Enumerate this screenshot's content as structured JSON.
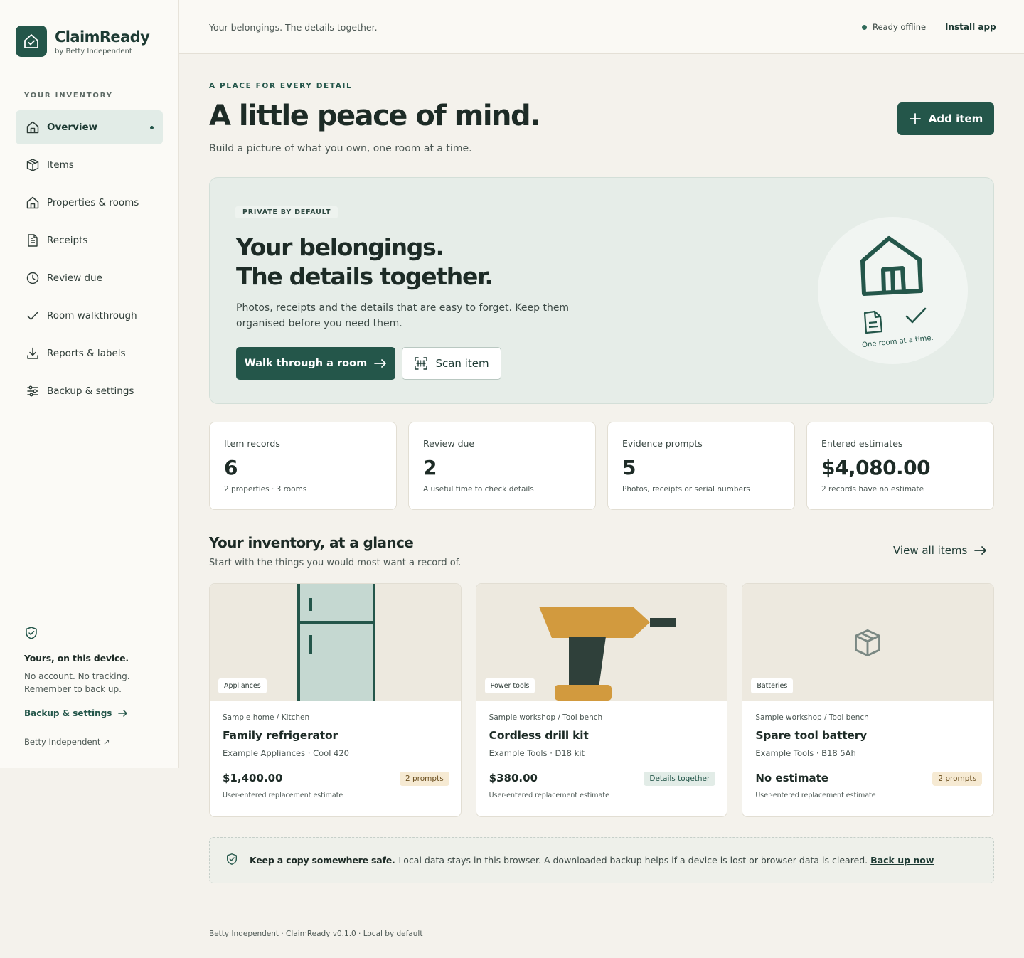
{
  "brand": {
    "name": "ClaimReady",
    "sub": "by Betty Independent"
  },
  "sidebar": {
    "heading": "YOUR INVENTORY",
    "items": [
      {
        "label": "Overview",
        "icon": "home-icon",
        "active": true
      },
      {
        "label": "Items",
        "icon": "box-icon"
      },
      {
        "label": "Properties & rooms",
        "icon": "home-icon"
      },
      {
        "label": "Receipts",
        "icon": "document-icon"
      },
      {
        "label": "Review due",
        "icon": "clock-icon"
      },
      {
        "label": "Room walkthrough",
        "icon": "check-icon"
      },
      {
        "label": "Reports & labels",
        "icon": "download-icon"
      },
      {
        "label": "Backup & settings",
        "icon": "sliders-icon"
      }
    ],
    "footer": {
      "title": "Yours, on this device.",
      "text1": "No account. No tracking.",
      "text2": "Remember to back up.",
      "link": "Backup & settings",
      "credit": "Betty Independent ↗"
    }
  },
  "topbar": {
    "tagline": "Your belongings. The details together.",
    "status": "Ready offline",
    "install": "Install app"
  },
  "page": {
    "eyebrow": "A PLACE FOR EVERY DETAIL",
    "title": "A little peace of mind.",
    "subtitle": "Build a picture of what you own, one room at a time.",
    "add_button": "Add item"
  },
  "hero": {
    "tag": "PRIVATE BY DEFAULT",
    "title_line1": "Your belongings.",
    "title_line2": "The details together.",
    "text": "Photos, receipts and the details that are easy to forget. Keep them organised before you need them.",
    "walk_button": "Walk through a room",
    "scan_button": "Scan item",
    "art_caption": "One room at a time."
  },
  "stats": [
    {
      "label": "Item records",
      "value": "6",
      "sub": "2 properties · 3 rooms"
    },
    {
      "label": "Review due",
      "value": "2",
      "sub": "A useful time to check details"
    },
    {
      "label": "Evidence prompts",
      "value": "5",
      "sub": "Photos, receipts or serial numbers"
    },
    {
      "label": "Entered estimates",
      "value": "$4,080.00",
      "sub": "2 records have no estimate"
    }
  ],
  "glance": {
    "title": "Your inventory, at a glance",
    "subtitle": "Start with the things you would most want a record of.",
    "view_all": "View all items"
  },
  "cards": [
    {
      "category": "Appliances",
      "location": "Sample home / Kitchen",
      "name": "Family refrigerator",
      "model": "Example Appliances · Cool 420",
      "price": "$1,400.00",
      "note": "User-entered replacement estimate",
      "badge": "2 prompts",
      "badge_type": "warn"
    },
    {
      "category": "Power tools",
      "location": "Sample workshop / Tool bench",
      "name": "Cordless drill kit",
      "model": "Example Tools · D18 kit",
      "price": "$380.00",
      "note": "User-entered replacement estimate",
      "badge": "Details together",
      "badge_type": "ok"
    },
    {
      "category": "Batteries",
      "location": "Sample workshop / Tool bench",
      "name": "Spare tool battery",
      "model": "Example Tools · B18 5Ah",
      "price": "No estimate",
      "note": "User-entered replacement estimate",
      "badge": "2 prompts",
      "badge_type": "warn"
    }
  ],
  "backup": {
    "strong": "Keep a copy somewhere safe.",
    "text": "Local data stays in this browser. A downloaded backup helps if a device is lost or browser data is cleared.",
    "link": "Back up now"
  },
  "footer": {
    "text": "Betty Independent · ClaimReady v0.1.0 · Local by default"
  },
  "colors": {
    "accent": "#24564a",
    "warn_bg": "#f6ead3",
    "ok_bg": "#e2ece7",
    "drill": "#d29a3e"
  }
}
